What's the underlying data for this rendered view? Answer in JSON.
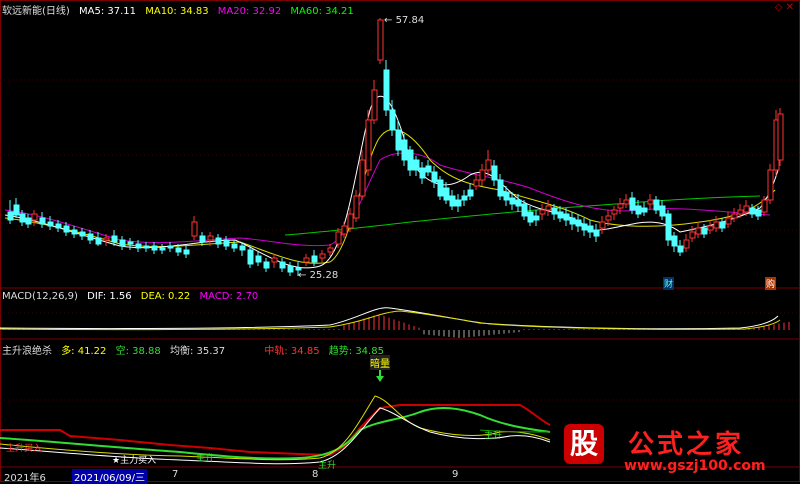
{
  "colors": {
    "bg": "#000000",
    "up": "#ff3232",
    "down": "#54ffff",
    "ma5": "#ffffff",
    "ma10": "#ffff00",
    "ma20": "#ff00ff",
    "ma60": "#00ff00",
    "frame": "#7a0000"
  },
  "main": {
    "title": "软远新能(日线)",
    "ma5_label": "MA5:",
    "ma5": "37.11",
    "ma10_label": "MA10:",
    "ma10": "34.83",
    "ma20_label": "MA20:",
    "ma20": "32.92",
    "ma60_label": "MA60:",
    "ma60": "34.21",
    "high_mark": "57.84",
    "low_mark": "25.28",
    "badge_cai": "财",
    "badge_mai": "购"
  },
  "macd": {
    "label": "MACD(12,26,9)",
    "dif_label": "DIF:",
    "dif": "1.56",
    "dea_label": "DEA:",
    "dea": "0.22",
    "macd_label": "MACD:",
    "macd": "2.70"
  },
  "indicator": {
    "title": "主升浪绝杀",
    "duo_label": "多:",
    "duo": "41.22",
    "kong_label": "空:",
    "kong": "38.88",
    "junheng_label": "均衡:",
    "junheng": "35.37",
    "zhongjun_label": "中轨:",
    "zhongjun": "34.85",
    "qushi_label": "趋势:",
    "qushi": "34.85",
    "signal_top": "暗量",
    "ann_zhengsheng": "主升",
    "ann_zhuli": "★主力买入",
    "ann_zhusheng2": "主升",
    "ann_zhusheng3": "主升",
    "ann_zhusheng4": "主升",
    "ann_left": "主升买入"
  },
  "timeline": {
    "year": "2021年6",
    "date": "2021/06/09/三",
    "m7": "7",
    "m8": "8",
    "m9": "9"
  },
  "watermark": {
    "logo": "股",
    "site": "公式之家",
    "url": "www.gszj100.com"
  }
}
